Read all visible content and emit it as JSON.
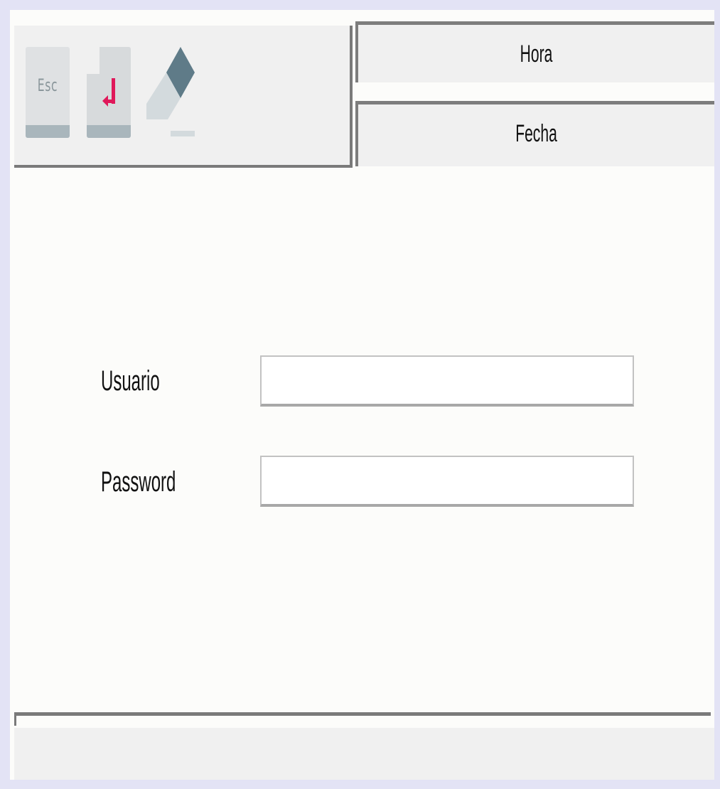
{
  "toolbar": {
    "escape_label": "Esc",
    "icons": [
      "escape-key-icon",
      "enter-key-icon",
      "eraser-icon"
    ]
  },
  "clock": {
    "hora_label": "Hora",
    "fecha_label": "Fecha"
  },
  "login": {
    "user_label": "Usuario",
    "user_value": "",
    "password_label": "Password",
    "password_value": ""
  },
  "colors": {
    "enter_arrow": "#e0185a",
    "eraser_dark": "#5f7b88",
    "eraser_light": "#d3dadd"
  }
}
